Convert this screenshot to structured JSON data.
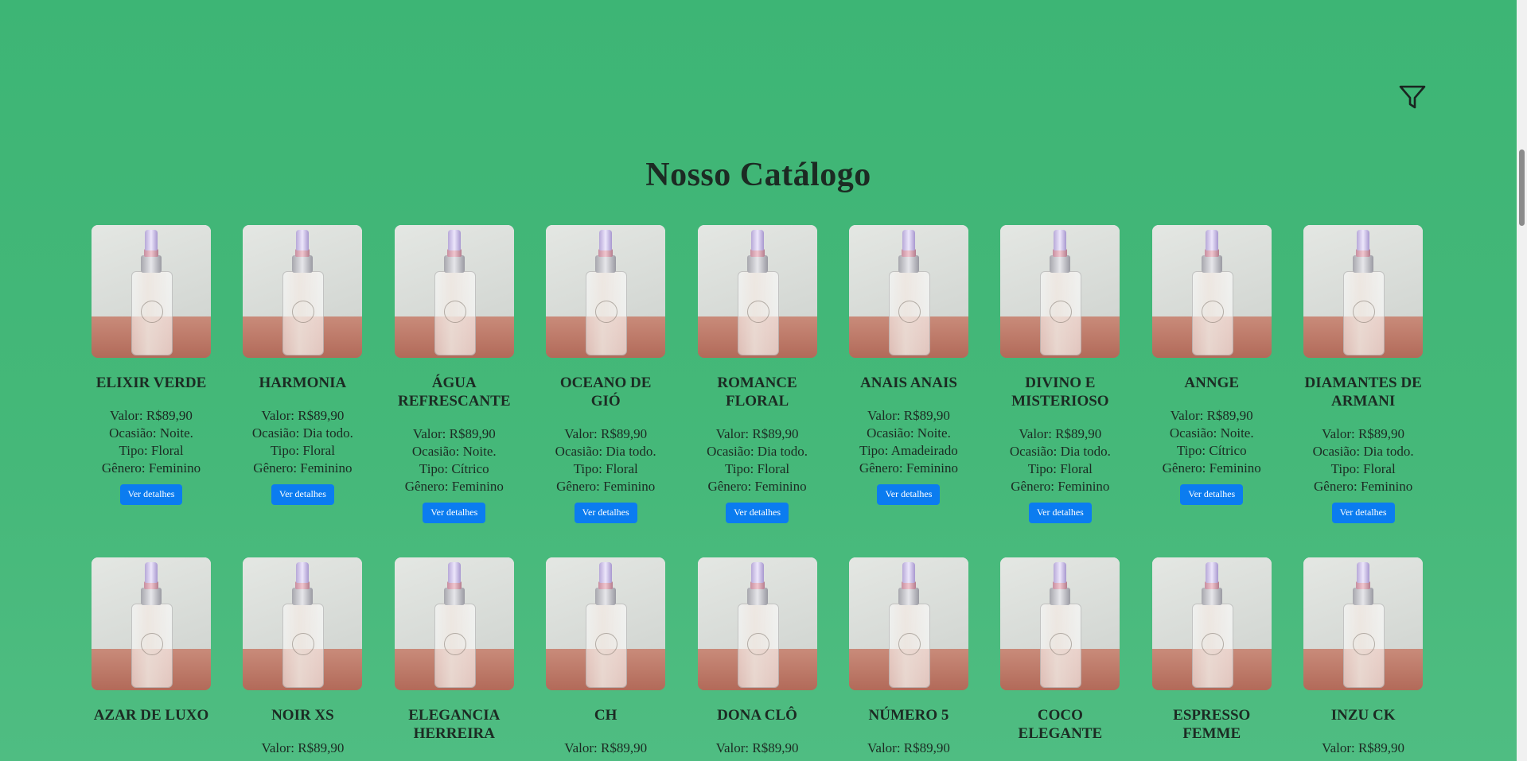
{
  "page": {
    "title": "Nosso Catálogo",
    "filter_icon": "filter-icon",
    "button_label": "Ver detalhes"
  },
  "products_row1": [
    {
      "name": "ELIXIR VERDE",
      "valor": "Valor: R$89,90",
      "ocasiao": "Ocasião: Noite.",
      "tipo": "Tipo: Floral",
      "genero": "Gênero: Feminino"
    },
    {
      "name": "HARMONIA",
      "valor": "Valor: R$89,90",
      "ocasiao": "Ocasião: Dia todo.",
      "tipo": "Tipo: Floral",
      "genero": "Gênero: Feminino"
    },
    {
      "name": "ÁGUA REFRESCANTE",
      "valor": "Valor: R$89,90",
      "ocasiao": "Ocasião: Noite.",
      "tipo": "Tipo: Cítrico",
      "genero": "Gênero: Feminino"
    },
    {
      "name": "OCEANO DE GIÓ",
      "valor": "Valor: R$89,90",
      "ocasiao": "Ocasião: Dia todo.",
      "tipo": "Tipo: Floral",
      "genero": "Gênero: Feminino"
    },
    {
      "name": "ROMANCE FLORAL",
      "valor": "Valor: R$89,90",
      "ocasiao": "Ocasião: Dia todo.",
      "tipo": "Tipo: Floral",
      "genero": "Gênero: Feminino"
    },
    {
      "name": "ANAIS ANAIS",
      "valor": "Valor: R$89,90",
      "ocasiao": "Ocasião: Noite.",
      "tipo": "Tipo: Amadeirado",
      "genero": "Gênero: Feminino"
    },
    {
      "name": "DIVINO E MISTERIOSO",
      "valor": "Valor: R$89,90",
      "ocasiao": "Ocasião: Dia todo.",
      "tipo": "Tipo: Floral",
      "genero": "Gênero: Feminino"
    },
    {
      "name": "ANNGE",
      "valor": "Valor: R$89,90",
      "ocasiao": "Ocasião: Noite.",
      "tipo": "Tipo: Cítrico",
      "genero": "Gênero: Feminino"
    },
    {
      "name": "DIAMANTES DE ARMANI",
      "valor": "Valor: R$89,90",
      "ocasiao": "Ocasião: Dia todo.",
      "tipo": "Tipo: Floral",
      "genero": "Gênero: Feminino"
    }
  ],
  "products_row2": [
    {
      "name": "AZAR DE LUXO",
      "valor": ""
    },
    {
      "name": "NOIR XS",
      "valor": "Valor: R$89,90"
    },
    {
      "name": "ELEGANCIA HERREIRA",
      "valor": ""
    },
    {
      "name": "CH",
      "valor": "Valor: R$89,90"
    },
    {
      "name": "DONA CLÔ",
      "valor": "Valor: R$89,90"
    },
    {
      "name": "NÚMERO 5",
      "valor": "Valor: R$89,90"
    },
    {
      "name": "COCO ELEGANTE",
      "valor": ""
    },
    {
      "name": "ESPRESSO FEMME",
      "valor": ""
    },
    {
      "name": "INZU CK",
      "valor": "Valor: R$89,90"
    }
  ]
}
